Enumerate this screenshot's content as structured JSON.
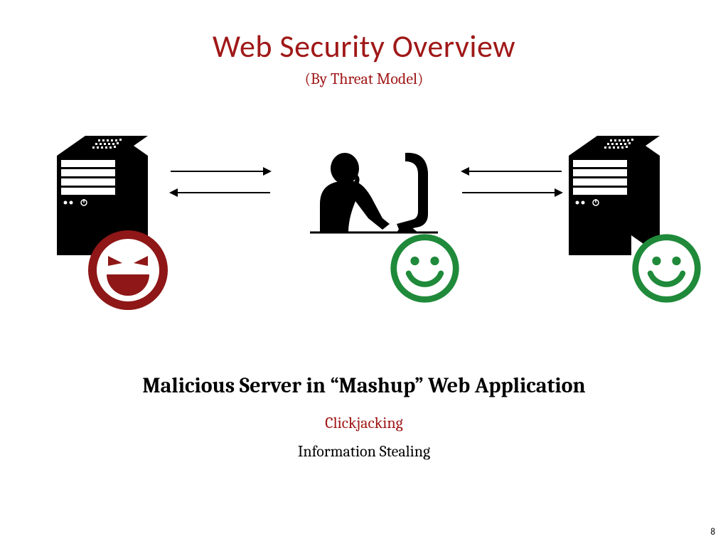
{
  "title": "Web Security Overview",
  "subtitle": "(By Threat Model)",
  "scenario": "Malicious Server in “Mashup” Web Application",
  "threats": {
    "t1": "Clickjacking",
    "t2": "Information Stealing"
  },
  "page_number": "8",
  "colors": {
    "accent_red": "#a01818",
    "evil_red": "#8f1717",
    "good_green": "#1f8a3a"
  }
}
